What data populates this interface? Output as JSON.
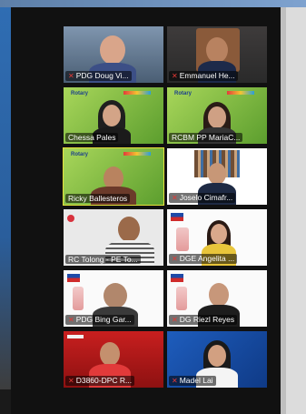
{
  "participants": [
    {
      "name": "PDG Doug Vi...",
      "muted": true,
      "active": false
    },
    {
      "name": "Emmanuel He...",
      "muted": true,
      "active": false
    },
    {
      "name": "Chessa Pales",
      "muted": false,
      "active": false
    },
    {
      "name": "RCBM PP MariaC...",
      "muted": false,
      "active": false
    },
    {
      "name": "Ricky Ballesteros",
      "muted": false,
      "active": true
    },
    {
      "name": "Joselo Cimafr...",
      "muted": true,
      "active": false
    },
    {
      "name": "RC Tolong - PE To...",
      "muted": false,
      "active": false
    },
    {
      "name": "DGE Angelita ...",
      "muted": true,
      "active": false
    },
    {
      "name": "PDG Bing Gar...",
      "muted": true,
      "active": false
    },
    {
      "name": "DG Riezl Reyes",
      "muted": true,
      "active": false
    },
    {
      "name": "D3860-DPC R...",
      "muted": true,
      "active": false
    },
    {
      "name": "Madel Lai",
      "muted": true,
      "active": false
    }
  ],
  "colors": {
    "active_border": "#e6e23a",
    "muted_icon": "#e53935"
  },
  "icons": {
    "muted": "mic-muted-icon"
  },
  "brand_text": {
    "rotary": "Rotary"
  }
}
